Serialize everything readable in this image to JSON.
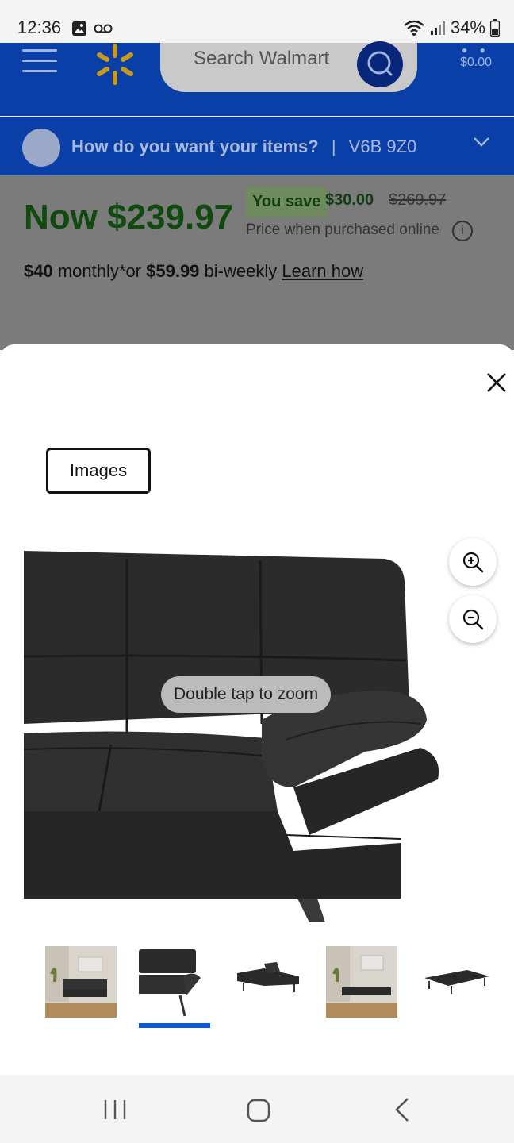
{
  "status_bar": {
    "time": "12:36",
    "battery": "34%"
  },
  "header": {
    "search_placeholder": "Search Walmart",
    "cart_total": "$0.00"
  },
  "delivery": {
    "question": "How do you want your items?",
    "separator": "|",
    "postal_code": "V6B 9Z0"
  },
  "price": {
    "now": "Now $239.97",
    "you_save_label": "You save",
    "save_amount": "$30.00",
    "was": "$269.97",
    "note": "Price when purchased online",
    "monthly_amount": "$40",
    "monthly_text": "monthly*or",
    "biweekly_amount": "$59.99",
    "biweekly_text": "bi-weekly",
    "learn_how": "Learn how"
  },
  "modal": {
    "tab_label": "Images",
    "hint": "Double tap to zoom",
    "thumbnails": [
      {
        "name": "thumb-room-view"
      },
      {
        "name": "thumb-closeup-armrest",
        "selected": true
      },
      {
        "name": "thumb-reclined"
      },
      {
        "name": "thumb-room-view-2"
      },
      {
        "name": "thumb-flat-bed"
      }
    ]
  },
  "colors": {
    "walmart_blue": "#0a3fa8",
    "spark_yellow": "#c79a1e",
    "price_green": "#114a11",
    "selected_indicator": "#0b5be0"
  }
}
